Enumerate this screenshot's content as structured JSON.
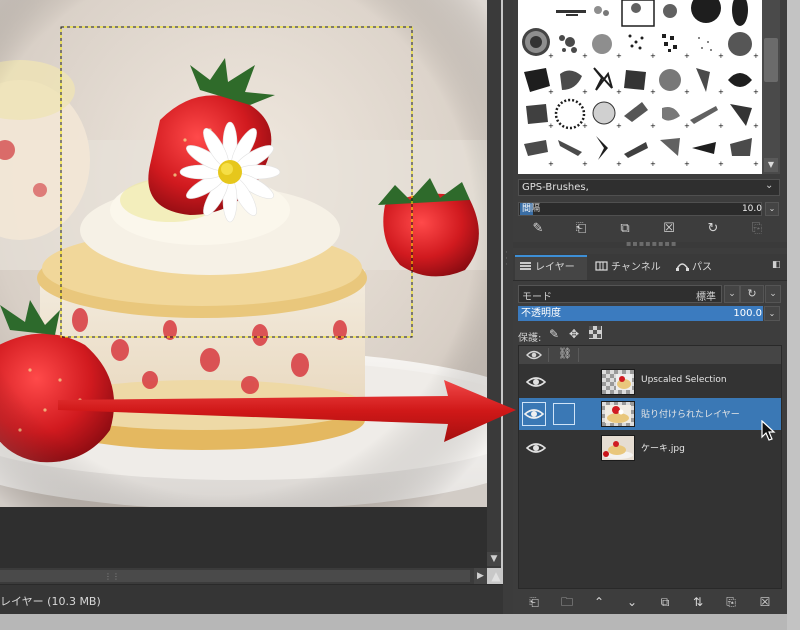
{
  "status_bar": {
    "text": "レイヤー (10.3 MB)"
  },
  "brushes": {
    "selected_name": "GPS-Brushes,",
    "spacing_icon": "間",
    "spacing_label": "隔",
    "spacing_value": "10.0"
  },
  "brush_toolbar": {
    "edit": "edit-brush-icon",
    "new": "new-brush-icon",
    "duplicate": "duplicate-brush-icon",
    "delete": "delete-brush-icon",
    "refresh": "refresh-brushes-icon",
    "open_as_image": "open-as-image-icon"
  },
  "tabs": {
    "layers": "レイヤー",
    "channels": "チャンネル",
    "paths": "パス"
  },
  "layers_panel": {
    "mode_label": "モード",
    "mode_value": "標準",
    "opacity_label": "不透明度",
    "opacity_value": "100.0",
    "lock_label": "保護:"
  },
  "layers": [
    {
      "name": "Upscaled Selection",
      "visible": true,
      "selected": false
    },
    {
      "name": "貼り付けられたレイヤー",
      "visible": true,
      "selected": true
    },
    {
      "name": "ケーキ.jpg",
      "visible": true,
      "selected": false
    }
  ],
  "layer_buttons": [
    "new-layer-icon",
    "new-layer-group-icon",
    "raise-layer-icon",
    "lower-layer-icon",
    "duplicate-layer-icon",
    "anchor-merge-icon",
    "layer-mask-icon",
    "delete-layer-icon"
  ],
  "colors": {
    "accent": "#3a78b5",
    "arrow": "#d01818",
    "selection_marquee": "#f2e600"
  }
}
